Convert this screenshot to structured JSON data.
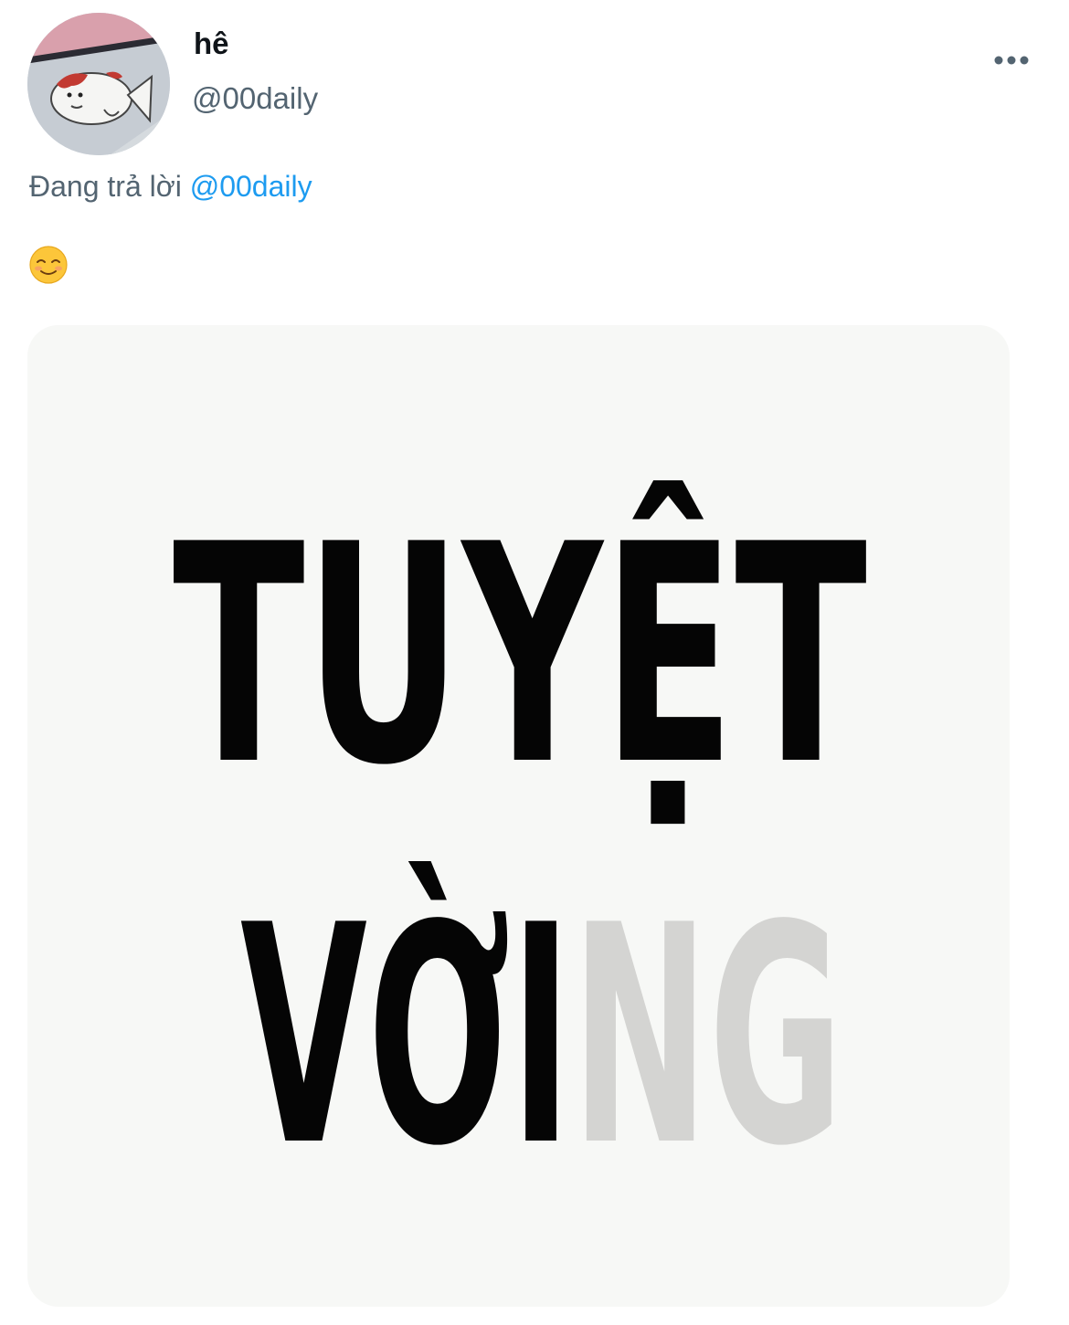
{
  "tweet": {
    "author": {
      "display_name": "hê",
      "handle": "@00daily",
      "avatar_icon": "fish-cartoon-avatar"
    },
    "more_icon": "more-horizontal-icon",
    "reply_context": {
      "prefix": "Đang trả lời",
      "mention": "@00daily"
    },
    "text": "☺️",
    "media": {
      "type": "image",
      "lines": [
        {
          "black": "TUYỆT",
          "gray": ""
        },
        {
          "black": "VỜI",
          "gray": "NG"
        }
      ]
    }
  },
  "colors": {
    "name": "#0f1419",
    "secondary": "#536471",
    "link": "#1d9bf0",
    "media_bg": "#f7f8f6",
    "media_text_black": "#050505",
    "media_text_gray": "#d4d4d2"
  }
}
